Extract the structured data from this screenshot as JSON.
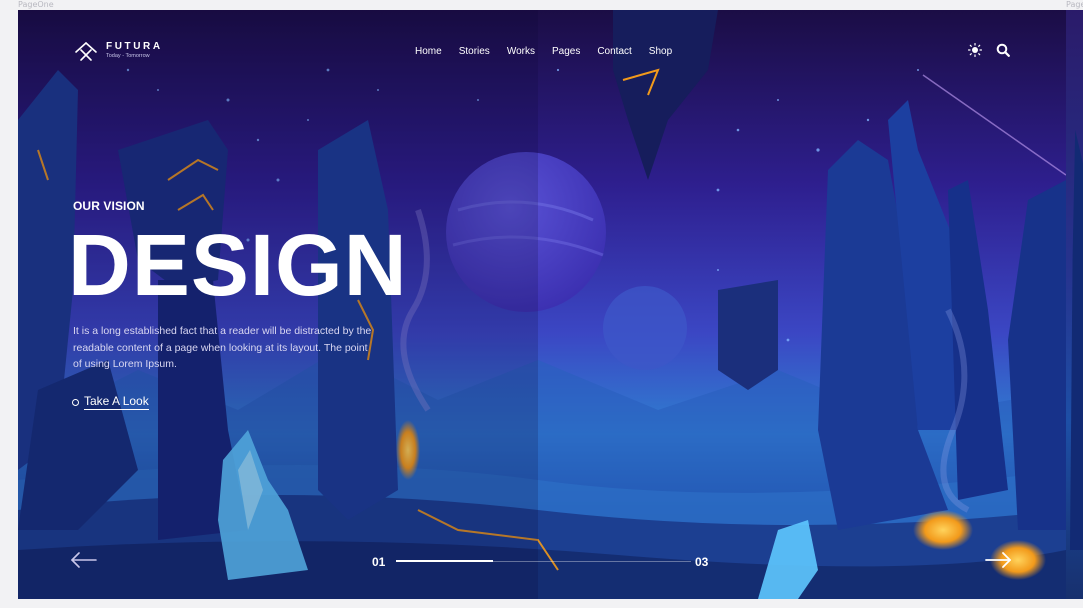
{
  "frame": {
    "left_label": "PageOne",
    "right_label": "Page"
  },
  "brand": {
    "name": "FUTURA",
    "tagline": "Today - Tomorrow",
    "logo_icon": "futura-x-logo-icon"
  },
  "nav": {
    "items": [
      {
        "label": "Home"
      },
      {
        "label": "Stories"
      },
      {
        "label": "Works"
      },
      {
        "label": "Pages"
      },
      {
        "label": "Contact"
      },
      {
        "label": "Shop"
      }
    ]
  },
  "header_icons": {
    "theme": "sun-icon",
    "search": "search-icon"
  },
  "hero": {
    "eyebrow": "OUR VISION",
    "title": "DESIGN",
    "body": "It is a long established fact that a reader will be distracted by the readable content of a page when looking at its layout. The point of using Lorem Ipsum.",
    "cta": "Take A Look"
  },
  "slider": {
    "current": "01",
    "total": "03",
    "progress": 0.33
  },
  "colors": {
    "accent": "#ffffff",
    "sky_top": "#1b0f4a",
    "sky_mid": "#3526a8",
    "glow": "#f6a623"
  }
}
